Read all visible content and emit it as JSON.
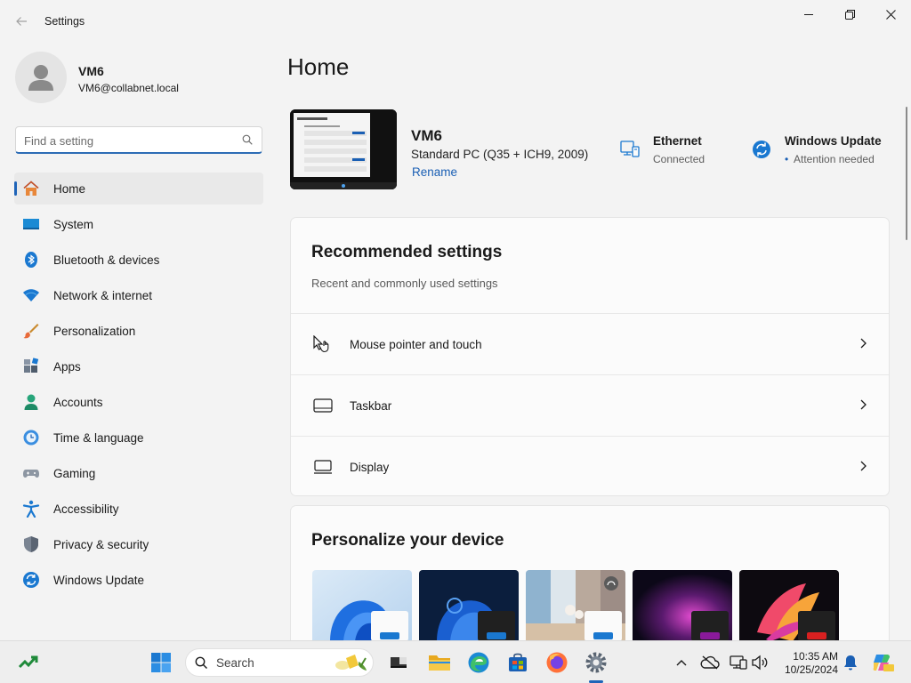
{
  "window": {
    "title": "Settings"
  },
  "user": {
    "name": "VM6",
    "email": "VM6@collabnet.local"
  },
  "search": {
    "placeholder": "Find a setting"
  },
  "sidebar": {
    "items": [
      {
        "label": "Home",
        "icon": "home-icon",
        "active": true
      },
      {
        "label": "System",
        "icon": "system-icon"
      },
      {
        "label": "Bluetooth & devices",
        "icon": "bluetooth-icon"
      },
      {
        "label": "Network & internet",
        "icon": "wifi-icon"
      },
      {
        "label": "Personalization",
        "icon": "brush-icon"
      },
      {
        "label": "Apps",
        "icon": "apps-icon"
      },
      {
        "label": "Accounts",
        "icon": "accounts-icon"
      },
      {
        "label": "Time & language",
        "icon": "clock-globe-icon"
      },
      {
        "label": "Gaming",
        "icon": "gamepad-icon"
      },
      {
        "label": "Accessibility",
        "icon": "accessibility-icon"
      },
      {
        "label": "Privacy & security",
        "icon": "shield-icon"
      },
      {
        "label": "Windows Update",
        "icon": "update-icon"
      }
    ]
  },
  "main": {
    "title": "Home",
    "device": {
      "name": "VM6",
      "model": "Standard PC (Q35 + ICH9, 2009)",
      "rename_label": "Rename"
    },
    "status": {
      "ethernet": {
        "title": "Ethernet",
        "subtitle": "Connected"
      },
      "update": {
        "title": "Windows Update",
        "subtitle": "Attention needed",
        "dot": "•"
      }
    },
    "recommended": {
      "title": "Recommended settings",
      "subtitle": "Recent and commonly used settings",
      "items": [
        {
          "label": "Mouse pointer and touch",
          "icon": "mouse-pointer-icon"
        },
        {
          "label": "Taskbar",
          "icon": "taskbar-icon"
        },
        {
          "label": "Display",
          "icon": "display-icon"
        }
      ]
    },
    "personalize": {
      "title": "Personalize your device",
      "themes": [
        "light-bloom",
        "dark-bloom",
        "captured-motion",
        "glow",
        "flow"
      ]
    }
  },
  "taskbar": {
    "search_label": "Search",
    "time": "10:35 AM",
    "date": "10/25/2024"
  },
  "colors": {
    "accent": "#1f64b8",
    "link": "#1a5fb4",
    "background": "#f3f3f3"
  }
}
